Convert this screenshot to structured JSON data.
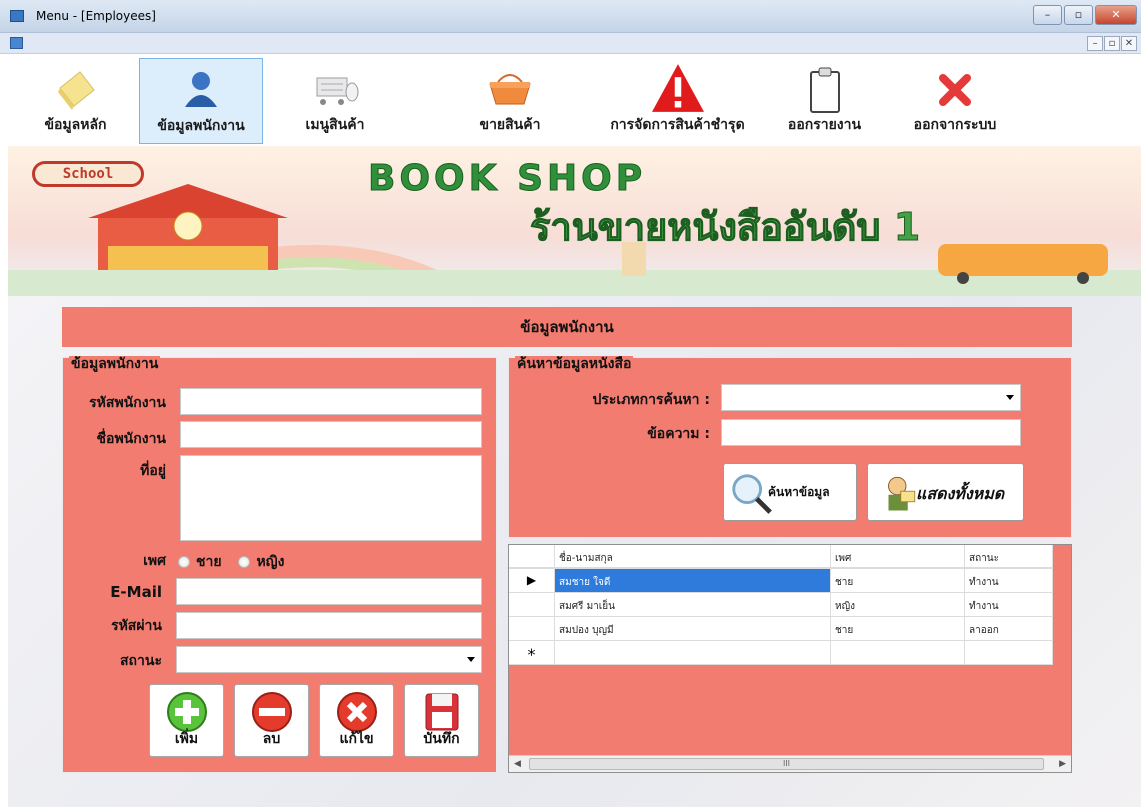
{
  "window": {
    "title": "Menu - [Employees]",
    "minimize": "–",
    "maximize": "▫",
    "close": "✕"
  },
  "mdi": {
    "minimize": "–",
    "restore": "▫",
    "close": "✕"
  },
  "menu": {
    "items": [
      {
        "label": "ข้อมูลหลัก",
        "icon": "note-icon"
      },
      {
        "label": "ข้อมูลพนักงาน",
        "icon": "user-icon"
      },
      {
        "label": "เมนูสินค้า",
        "icon": "cart-icon"
      },
      {
        "label": "ขายสินค้า",
        "icon": "basket-icon"
      },
      {
        "label": "การจัดการสินค้าชำรุด",
        "icon": "warning-icon"
      },
      {
        "label": "ออกรายงาน",
        "icon": "clipboard-icon"
      },
      {
        "label": "ออกจากระบบ",
        "icon": "close-x-icon"
      }
    ],
    "active_index": 1
  },
  "banner": {
    "badge": "School",
    "title": "BOOK SHOP",
    "subtitle": "ร้านขายหนังสืออันดับ 1"
  },
  "section_title": "ข้อมูลพนักงาน",
  "employee_group": {
    "legend": "ข้อมูลพนักงาน",
    "labels": {
      "id": "รหัสพนักงาน",
      "name": "ชื่อพนักงาน",
      "address": "ที่อยู่",
      "gender": "เพศ",
      "email": "E-Mail",
      "password": "รหัสผ่าน",
      "status": "สถานะ"
    },
    "values": {
      "id": "",
      "name": "",
      "address": "",
      "email": "",
      "password": "",
      "status": ""
    },
    "gender_options": [
      "ชาย",
      "หญิง"
    ],
    "buttons": {
      "add": "เพิ่ม",
      "delete": "ลบ",
      "edit": "แก้ไข",
      "save": "บันทึก"
    }
  },
  "search_group": {
    "legend": "ค้นหาข้อมูลหนังสือ",
    "type_label": "ประเภทการค้นหา :",
    "text_label": "ข้อความ :",
    "type_value": "",
    "text_value": "",
    "search_button": "ค้นหาข้อมูล",
    "show_all_button": "แสดงทั้งหมด"
  },
  "grid": {
    "columns": [
      "ชื่อ-นามสกุล",
      "เพศ",
      "สถานะ"
    ],
    "rows": [
      {
        "marker": "▶",
        "name": "สมชาย ใจดี",
        "gender": "ชาย",
        "status": "ทำงาน"
      },
      {
        "marker": "",
        "name": "สมศรี มาเย็น",
        "gender": "หญิง",
        "status": "ทำงาน"
      },
      {
        "marker": "",
        "name": "สมปอง บุญมี",
        "gender": "ชาย",
        "status": "ลาออก"
      }
    ],
    "new_row_marker": "*",
    "scroll_thumb": "III",
    "scroll_left": "◀",
    "scroll_right": "▶"
  },
  "colors": {
    "accent": "#f27c70",
    "selection": "#2e7bdc"
  }
}
